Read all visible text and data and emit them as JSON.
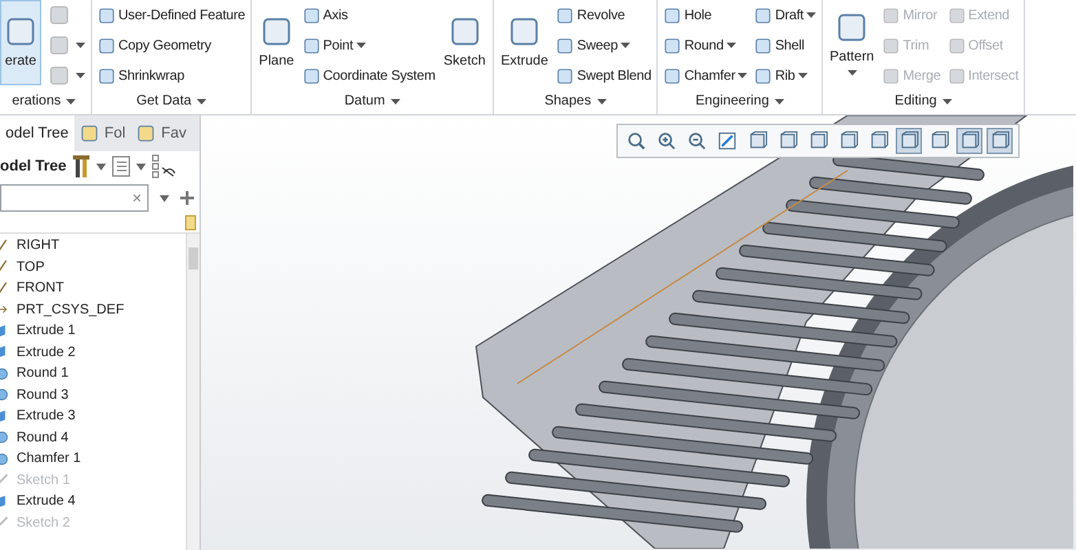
{
  "ribbon": {
    "groups": [
      {
        "label": "erations",
        "columns": [
          [
            {
              "kind": "large",
              "label": "erate",
              "selected": true,
              "disabled": false,
              "dropdown": false
            }
          ],
          [
            {
              "kind": "icon",
              "disabled": true,
              "dropdown": false
            },
            {
              "kind": "icon",
              "disabled": true,
              "dropdown": true
            },
            {
              "kind": "icon",
              "disabled": true,
              "dropdown": true
            }
          ]
        ]
      },
      {
        "label": "Get Data",
        "columns": [
          [
            {
              "kind": "small",
              "label": "User-Defined Feature",
              "disabled": false,
              "dropdown": false
            },
            {
              "kind": "small",
              "label": "Copy Geometry",
              "disabled": false,
              "dropdown": false
            },
            {
              "kind": "small",
              "label": "Shrinkwrap",
              "disabled": false,
              "dropdown": false
            }
          ]
        ]
      },
      {
        "label": "Datum",
        "columns": [
          [
            {
              "kind": "large",
              "label": "Plane",
              "disabled": false,
              "dropdown": false
            }
          ],
          [
            {
              "kind": "small",
              "label": "Axis",
              "disabled": false,
              "dropdown": false
            },
            {
              "kind": "small",
              "label": "Point",
              "disabled": false,
              "dropdown": true
            },
            {
              "kind": "small",
              "label": "Coordinate System",
              "disabled": false,
              "dropdown": false
            }
          ],
          [
            {
              "kind": "large",
              "label": "Sketch",
              "disabled": false,
              "dropdown": false
            }
          ]
        ]
      },
      {
        "label": "Shapes",
        "columns": [
          [
            {
              "kind": "large",
              "label": "Extrude",
              "disabled": false,
              "dropdown": false
            }
          ],
          [
            {
              "kind": "small",
              "label": "Revolve",
              "disabled": false,
              "dropdown": false
            },
            {
              "kind": "small",
              "label": "Sweep",
              "disabled": false,
              "dropdown": true
            },
            {
              "kind": "small",
              "label": "Swept Blend",
              "disabled": false,
              "dropdown": false
            }
          ]
        ]
      },
      {
        "label": "Engineering",
        "columns": [
          [
            {
              "kind": "small",
              "label": "Hole",
              "disabled": false,
              "dropdown": false
            },
            {
              "kind": "small",
              "label": "Round",
              "disabled": false,
              "dropdown": true
            },
            {
              "kind": "small",
              "label": "Chamfer",
              "disabled": false,
              "dropdown": true
            }
          ],
          [
            {
              "kind": "small",
              "label": "Draft",
              "disabled": false,
              "dropdown": true
            },
            {
              "kind": "small",
              "label": "Shell",
              "disabled": false,
              "dropdown": false
            },
            {
              "kind": "small",
              "label": "Rib",
              "disabled": false,
              "dropdown": true
            }
          ]
        ]
      },
      {
        "label": "Editing",
        "columns": [
          [
            {
              "kind": "large",
              "label": "Pattern",
              "disabled": false,
              "dropdown": true
            }
          ],
          [
            {
              "kind": "small",
              "label": "Mirror",
              "disabled": true,
              "dropdown": false
            },
            {
              "kind": "small",
              "label": "Trim",
              "disabled": true,
              "dropdown": false
            },
            {
              "kind": "small",
              "label": "Merge",
              "disabled": true,
              "dropdown": false
            }
          ],
          [
            {
              "kind": "small",
              "label": "Extend",
              "disabled": true,
              "dropdown": false
            },
            {
              "kind": "small",
              "label": "Offset",
              "disabled": true,
              "dropdown": false
            },
            {
              "kind": "small",
              "label": "Intersect",
              "disabled": true,
              "dropdown": false
            }
          ]
        ]
      }
    ]
  },
  "panel": {
    "tabs": [
      {
        "label": "odel Tree",
        "selected": true
      },
      {
        "label": "Fol",
        "selected": false
      },
      {
        "label": "Fav",
        "selected": false
      }
    ],
    "toolbar_label": "odel Tree",
    "search": {
      "clear": "×"
    },
    "tree": [
      {
        "kind": "plane",
        "label": "RIGHT",
        "disabled": false
      },
      {
        "kind": "plane",
        "label": "TOP",
        "disabled": false
      },
      {
        "kind": "plane",
        "label": "FRONT",
        "disabled": false
      },
      {
        "kind": "csys",
        "label": "PRT_CSYS_DEF",
        "disabled": false
      },
      {
        "kind": "extrude",
        "label": "Extrude 1",
        "disabled": false
      },
      {
        "kind": "extrude",
        "label": "Extrude 2",
        "disabled": false
      },
      {
        "kind": "round",
        "label": "Round 1",
        "disabled": false
      },
      {
        "kind": "round",
        "label": "Round 3",
        "disabled": false
      },
      {
        "kind": "extrude",
        "label": "Extrude 3",
        "disabled": false
      },
      {
        "kind": "round",
        "label": "Round 4",
        "disabled": false
      },
      {
        "kind": "round",
        "label": "Chamfer 1",
        "disabled": false
      },
      {
        "kind": "sketch",
        "label": "Sketch 1",
        "disabled": true
      },
      {
        "kind": "extrude",
        "label": "Extrude 4",
        "disabled": false
      },
      {
        "kind": "sketch",
        "label": "Sketch 2",
        "disabled": true
      }
    ]
  },
  "view_toolbar": [
    {
      "selected": false
    },
    {
      "selected": false
    },
    {
      "selected": false
    },
    {
      "selected": false
    },
    {
      "selected": false
    },
    {
      "selected": false
    },
    {
      "selected": false
    },
    {
      "selected": false
    },
    {
      "selected": false
    },
    {
      "selected": true
    },
    {
      "selected": false
    },
    {
      "selected": true
    },
    {
      "selected": true
    }
  ]
}
